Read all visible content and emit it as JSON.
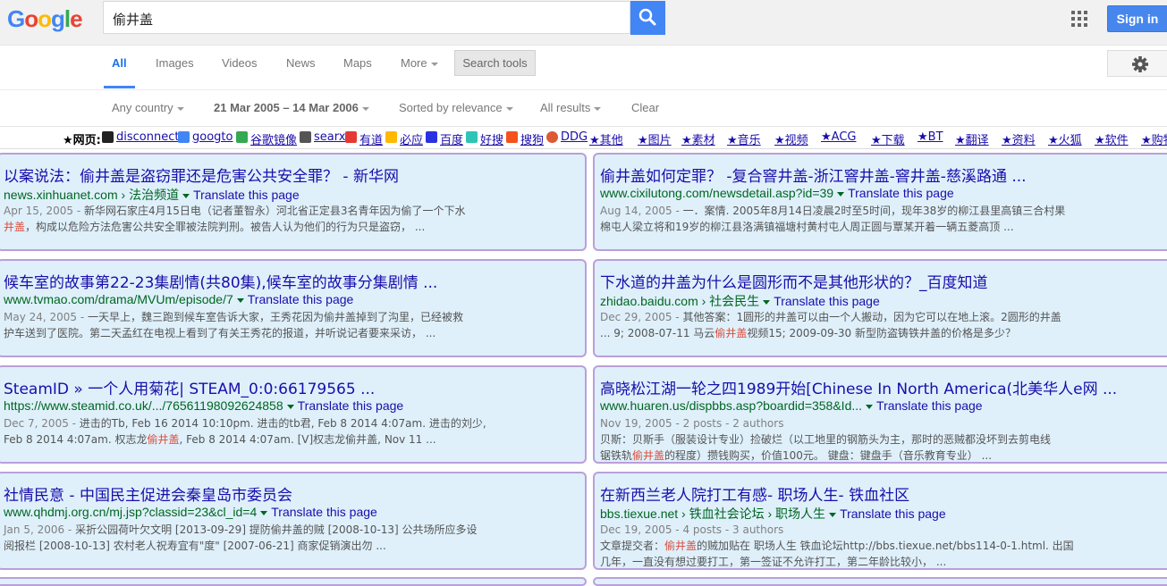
{
  "search": {
    "query": "偷井盖",
    "signin_label": "Sign in"
  },
  "nav": {
    "tabs": [
      {
        "label": "All"
      },
      {
        "label": "Images"
      },
      {
        "label": "Videos"
      },
      {
        "label": "News"
      },
      {
        "label": "Maps"
      },
      {
        "label": "More"
      }
    ],
    "tools_label": "Search tools"
  },
  "tools": {
    "country": "Any country",
    "date_range": "21 Mar 2005 – 14 Mar 2006",
    "sort": "Sorted by relevance",
    "results": "All results",
    "clear": "Clear"
  },
  "linkbar": {
    "label": "★网页:",
    "links": [
      "disconnect",
      "googto",
      "谷歌镜像",
      "searx",
      "有道",
      "必应",
      "百度",
      "好搜",
      "搜狗",
      "DDG",
      "★其他",
      "★图片",
      "★素材",
      "★音乐",
      "★视频",
      "★ACG",
      "★下载",
      "★BT",
      "★翻译",
      "★资料",
      "★火狐",
      "★软件",
      "★购物"
    ]
  },
  "results": [
    {
      "title": "以案说法：偷井盖是盗窃罪还是危害公共安全罪？ - 新华网",
      "url": "news.xinhuanet.com › 法治频道",
      "translate": "Translate this page",
      "date": "Apr 15, 2005 - ",
      "line1": "新华网石家庄4月15日电（记者董智永）河北省正定县3名青年因为偷了一个下水",
      "line2_pre": "",
      "line2_hl": "井盖",
      "line2_post": "，构成以危险方法危害公共安全罪被法院判刑。被告人认为他们的行为只是盗窃， ..."
    },
    {
      "title": "偷井盖如何定罪？ -复合窨井盖-浙江窨井盖-窨井盖-慈溪路通 ...",
      "url": "www.cixilutong.com/newsdetail.asp?id=39",
      "translate": "Translate this page",
      "date": "Aug 14, 2005 - ",
      "line1": "一．案情. 2005年8月14日凌晨2时至5时间，现年38岁的柳江县里高镇三合村果",
      "line2_pre": "棉屯人梁立将和19岁的柳江县洛满镇福塘村黄村屯人周正圆与覃某开着一辆五菱高顶 ...",
      "line2_hl": "",
      "line2_post": ""
    },
    {
      "title": "候车室的故事第22-23集剧情(共80集),候车室的故事分集剧情 ...",
      "url": "www.tvmao.com/drama/MVUm/episode/7",
      "translate": "Translate this page",
      "date": "May 24, 2005 - ",
      "line1": "一天早上，魏三跑到候车室告诉大家，王秀花因为偷井盖掉到了沟里，已经被救",
      "line2_pre": "护车送到了医院。第二天孟红在电视上看到了有关王秀花的报道，并听说记者要来采访， ...",
      "line2_hl": "",
      "line2_post": ""
    },
    {
      "title": "下水道的井盖为什么是圆形而不是其他形状的？_百度知道",
      "url": "zhidao.baidu.com › 社会民生",
      "translate": "Translate this page",
      "date": "Dec 29, 2005 - ",
      "line1": "其他答案：1圆形的井盖可以由一个人搬动，因为它可以在地上滚。2圆形的井盖",
      "line2_pre": "... 9; 2008-07-11 马云",
      "line2_hl": "偷井盖",
      "line2_post": "视频15; 2009-09-30 新型防盗铸铁井盖的价格是多少？"
    },
    {
      "title": "SteamID » 一个人用菊花| STEAM_0:0:66179565 ...",
      "url": "https://www.steamid.co.uk/.../76561198092624858",
      "translate": "Translate this page",
      "date": "Dec 7, 2005 - ",
      "line1": "进击的Tb, Feb 16 2014 10:10pm. 进击的tb君, Feb 8 2014 4:07am. 进击的刘少,",
      "line2_pre": "Feb 8 2014 4:07am. 权志龙",
      "line2_hl": "偷井盖",
      "line2_post": ", Feb 8 2014 4:07am. [V]权志龙偷井盖, Nov 11 ..."
    },
    {
      "title": "高晓松江湖一轮之四1989开始[Chinese In North America(北美华人e网 ...",
      "url": "www.huaren.us/dispbbs.asp?boardid=358&Id...",
      "translate": "Translate this page",
      "date": "Nov 19, 2005 - ",
      "line1": "2 posts - 2 authors",
      "line2_pre": "贝斯：贝斯手（服装设计专业）捡破烂（以工地里的钢筋头为主，那时的恶贼都没坏到去剪电线",
      "line2_hl": "",
      "line2_post": "",
      "line3_pre": "锯铁轨",
      "line3_hl": "偷井盖",
      "line3_post": "的程度）攒钱购买，价值100元。 键盘：键盘手（音乐教育专业） ..."
    },
    {
      "title": "社情民意 - 中国民主促进会秦皇岛市委员会",
      "url": "www.qhdmj.org.cn/mj.jsp?classid=23&cl_id=4",
      "translate": "Translate this page",
      "date": "Jan 5, 2006 - ",
      "line1": "采折公园荷叶欠文明 [2013-09-29] 提防偷井盖的贼 [2008-10-13] 公共场所应多设",
      "line2_pre": "阅报栏 [2008-10-13] 农村老人祝寿宜有\"度\" [2007-06-21] 商家促销演出勿 ...",
      "line2_hl": "",
      "line2_post": ""
    },
    {
      "title": "在新西兰老人院打工有感- 职场人生- 铁血社区",
      "url": "bbs.tiexue.net › 铁血社会论坛 › 职场人生",
      "translate": "Translate this page",
      "date": "Dec 19, 2005 - ",
      "line1": "4 posts - 3 authors",
      "line2_pre": "文章提交者：",
      "line2_hl": "偷井盖",
      "line2_post": "的贼加贴在 职场人生 铁血论坛http://bbs.tiexue.net/bbs114-0-1.html. 出国",
      "line3_pre": "几年，一直没有想过要打工，第一签证不允许打工，第二年龄比较小， ...",
      "line3_hl": "",
      "line3_post": ""
    }
  ]
}
